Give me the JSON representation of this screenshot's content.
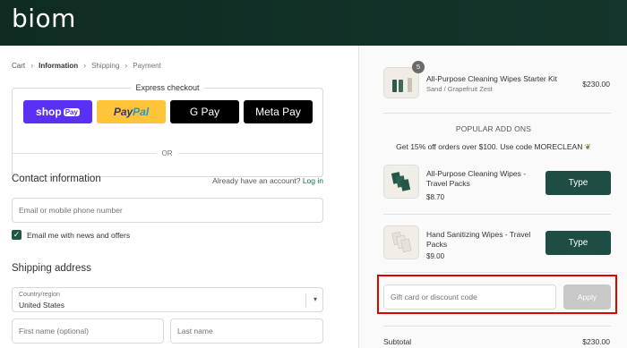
{
  "header": {
    "logo": "biom"
  },
  "breadcrumb": {
    "cart": "Cart",
    "information": "Information",
    "shipping": "Shipping",
    "payment": "Payment"
  },
  "express": {
    "title": "Express checkout",
    "shop": "shop",
    "shop_pay": "Pay",
    "paypal_a": "Pay",
    "paypal_b": "Pal",
    "gpay": "G Pay",
    "metapay": "Meta Pay"
  },
  "or": "OR",
  "contact": {
    "title": "Contact information",
    "have_account": "Already have an account?",
    "login": "Log in",
    "email_placeholder": "Email or mobile phone number",
    "newsletter": "Email me with news and offers"
  },
  "shipping": {
    "title": "Shipping address",
    "country_label": "Country/region",
    "country_value": "United States",
    "first_name": "First name (optional)",
    "last_name": "Last name"
  },
  "cart": {
    "item": {
      "quantity": "5",
      "name": "All-Purpose Cleaning Wipes Starter Kit",
      "variant": "Sand / Grapefruit Zest",
      "price": "$230.00"
    },
    "addons_title": "POPULAR ADD ONS",
    "promo": "Get 15% off orders over $100. Use code MORECLEAN",
    "addons": [
      {
        "name": "All-Purpose Cleaning Wipes - Travel Packs",
        "price": "$8.70",
        "button": "Type"
      },
      {
        "name": "Hand Sanitizing Wipes - Travel Packs",
        "price": "$9.00",
        "button": "Type"
      }
    ],
    "gift_placeholder": "Gift card or discount code",
    "apply": "Apply",
    "subtotal_label": "Subtotal",
    "subtotal_value": "$230.00"
  },
  "colors": {
    "header_bg": "#14352b",
    "accent": "#1d4d43",
    "highlight": "#e00000"
  }
}
